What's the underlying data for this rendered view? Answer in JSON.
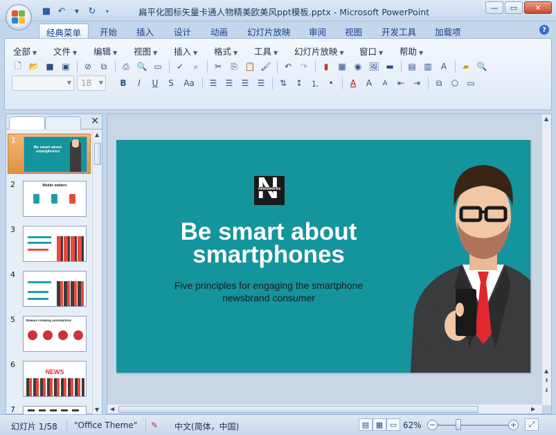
{
  "window": {
    "title": "扁平化图标矢量卡通人物精美欧美风ppt模板.pptx - Microsoft PowerPoint",
    "minimize": "—",
    "maximize": "▭",
    "close": "✕"
  },
  "ribbon_tabs": [
    "经典菜单",
    "开始",
    "插入",
    "设计",
    "动画",
    "幻灯片放映",
    "审阅",
    "视图",
    "开发工具",
    "加载项"
  ],
  "menu": [
    "全部",
    "文件",
    "编辑",
    "视图",
    "插入",
    "格式",
    "工具",
    "幻灯片放映",
    "窗口",
    "帮助"
  ],
  "font": {
    "name": "",
    "size": "18"
  },
  "format_buttons": {
    "bold": "B",
    "italic": "I",
    "underline": "U",
    "strike": "S",
    "case": "Aa"
  },
  "pane": {
    "close": "✕"
  },
  "thumbnails": [
    {
      "num": "1",
      "title": "Be smart about smartphones",
      "selected": true
    },
    {
      "num": "2",
      "title": "Mobile matters"
    },
    {
      "num": "3",
      "title": ""
    },
    {
      "num": "4",
      "title": ""
    },
    {
      "num": "5",
      "title": "Beware creeping assumptions"
    },
    {
      "num": "6",
      "title": "NEWS"
    },
    {
      "num": "7",
      "title": ""
    }
  ],
  "slide": {
    "logo_letter": "N",
    "logo_text": "newsworks",
    "title": "Be smart about smartphones",
    "subtitle": "Five principles  for engaging  the smartphone  newsbrand  consumer"
  },
  "status": {
    "slide_info": "幻灯片 1/58",
    "theme": "\"Office Theme\"",
    "language": "中文(简体，中国)",
    "zoom": "62%"
  },
  "colors": {
    "slide_bg": "#14949d",
    "selected_thumb": "#e0913d"
  }
}
